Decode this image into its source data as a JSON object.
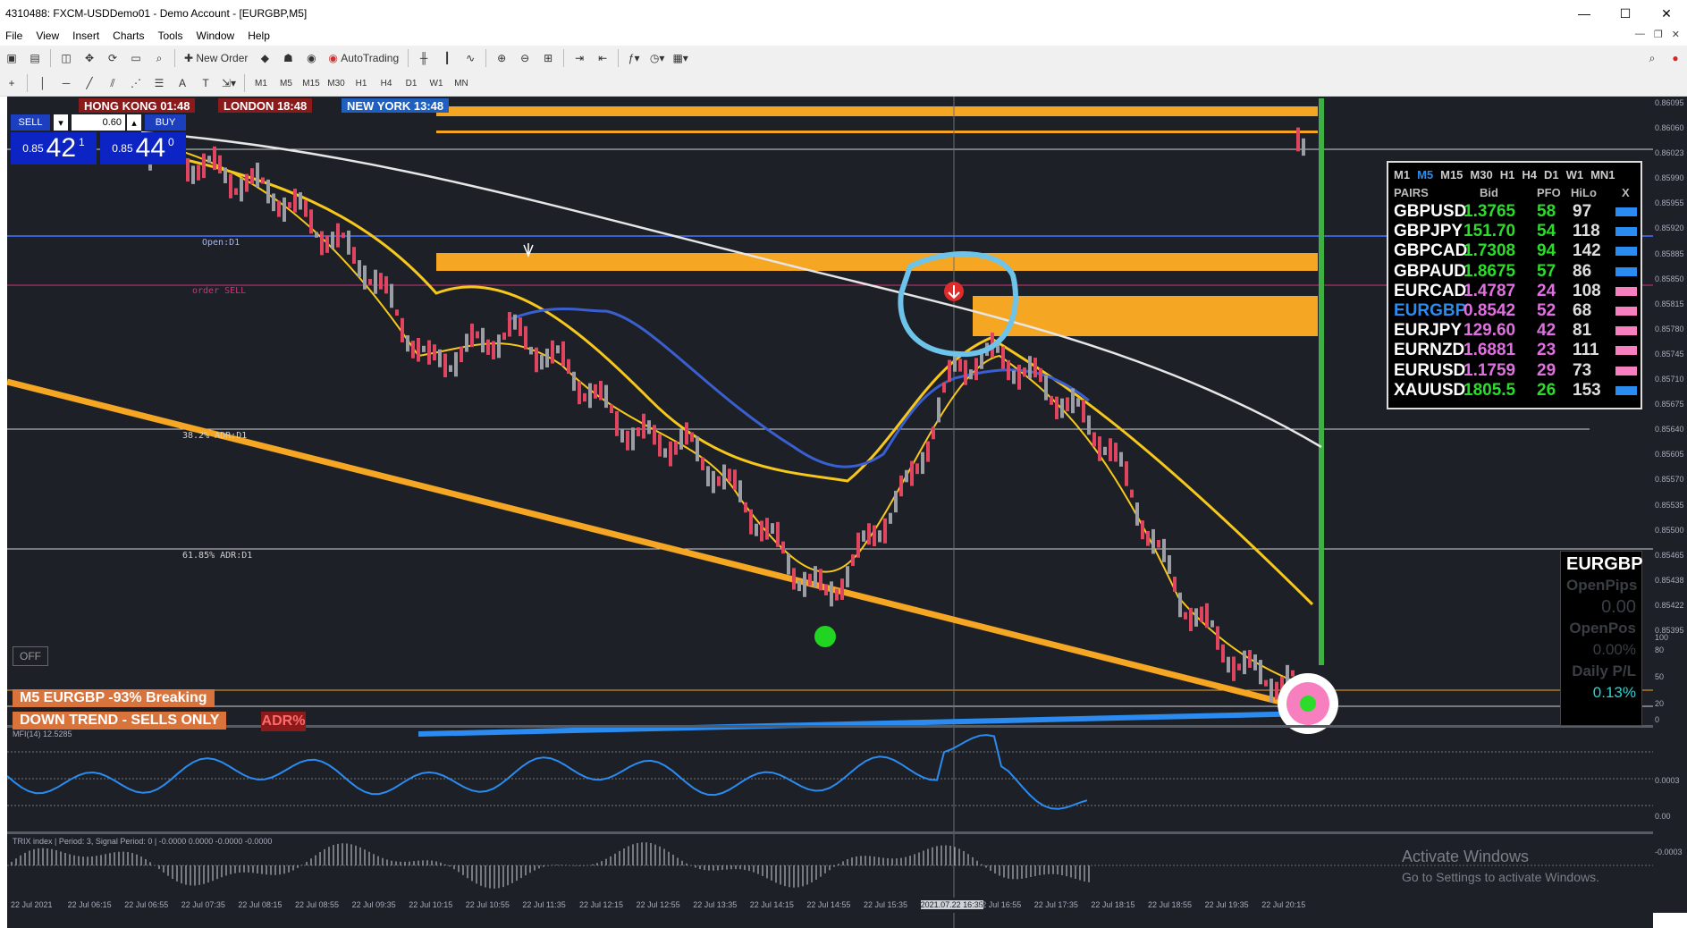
{
  "window": {
    "title": "4310488: FXCM-USDDemo01 - Demo Account - [EURGBP,M5]"
  },
  "menu": [
    "File",
    "View",
    "Insert",
    "Charts",
    "Tools",
    "Window",
    "Help"
  ],
  "toolbar": {
    "new_order": "New Order",
    "autotrading": "AutoTrading"
  },
  "timeframes": [
    "M1",
    "M5",
    "M15",
    "M30",
    "H1",
    "H4",
    "D1",
    "W1",
    "MN"
  ],
  "chart": {
    "symbol": "EURGBP,M5",
    "sessions": [
      {
        "label": "HONG KONG 01:48",
        "color": "#8b1a1a"
      },
      {
        "label": "LONDON  18:48",
        "color": "#8b1a1a"
      },
      {
        "label": "NEW YORK 13:48",
        "color": "#1f5fbf"
      }
    ],
    "trade": {
      "sell_label": "SELL",
      "buy_label": "BUY",
      "lot": "0.60",
      "sell_prefix": "0.85",
      "sell_big": "42",
      "sell_sup": "1",
      "buy_prefix": "0.85",
      "buy_big": "44",
      "buy_sup": "0"
    },
    "labels": {
      "open_d1": "Open:D1",
      "order_sell": "order SELL",
      "adr_382": "38.2% ADR:D1",
      "adr_618": "61.85% ADR:D1",
      "off": "OFF",
      "adr_badge": "ADR%"
    },
    "banners": {
      "breaking": "M5 EURGBP -93% Breaking",
      "trend": "DOWN TREND - SELLS ONLY"
    },
    "mfi_label": "MFI(14) 12.5285",
    "trix_label": "TRIX index | Period: 3, Signal Period: 0 | -0.0000 0.0000 -0.0000 -0.0000"
  },
  "price_scale": [
    "0.86095",
    "0.86060",
    "0.86023",
    "0.85990",
    "0.85955",
    "0.85920",
    "0.85885",
    "0.85850",
    "0.85815",
    "0.85780",
    "0.85745",
    "0.85710",
    "0.85675",
    "0.85640",
    "0.85605",
    "0.85570",
    "0.85535",
    "0.85500",
    "0.85465",
    "0.85438",
    "0.85422",
    "0.85395"
  ],
  "mfi_scale": [
    "100",
    "80",
    "50",
    "20",
    "0"
  ],
  "trix_scale": [
    "0.0003",
    "0.00",
    "-0.0003"
  ],
  "time_axis": [
    "22 Jul 2021",
    "22 Jul 06:15",
    "22 Jul 06:55",
    "22 Jul 07:35",
    "22 Jul 08:15",
    "22 Jul 08:55",
    "22 Jul 09:35",
    "22 Jul 10:15",
    "22 Jul 10:55",
    "22 Jul 11:35",
    "22 Jul 12:15",
    "22 Jul 12:55",
    "22 Jul 13:35",
    "22 Jul 14:15",
    "22 Jul 14:55",
    "22 Jul 15:35",
    "2021.07.22 16:35",
    "22 Jul 16:55",
    "22 Jul 17:35",
    "22 Jul 18:15",
    "22 Jul 18:55",
    "22 Jul 19:35",
    "22 Jul 20:15"
  ],
  "pairs_panel": {
    "timeframes": [
      "M1",
      "M5",
      "M15",
      "M30",
      "H1",
      "H4",
      "D1",
      "W1",
      "MN1"
    ],
    "active_tf": "M5",
    "headers": {
      "pairs": "PAIRS",
      "bid": "Bid",
      "pfo": "PFO",
      "hilo": "HiLo",
      "x": "X"
    },
    "rows": [
      {
        "pair": "GBPUSD",
        "bid": "1.3765",
        "pfo": "58",
        "hilo": "97",
        "bid_color": "#2bdc2b",
        "pfo_color": "#2bdc2b",
        "swatch": "#2a8cf0",
        "pair_color": "#ffffff"
      },
      {
        "pair": "GBPJPY",
        "bid": "151.70",
        "pfo": "54",
        "hilo": "118",
        "bid_color": "#2bdc2b",
        "pfo_color": "#2bdc2b",
        "swatch": "#2a8cf0",
        "pair_color": "#ffffff"
      },
      {
        "pair": "GBPCAD",
        "bid": "1.7308",
        "pfo": "94",
        "hilo": "142",
        "bid_color": "#2bdc2b",
        "pfo_color": "#2bdc2b",
        "swatch": "#2a8cf0",
        "pair_color": "#ffffff"
      },
      {
        "pair": "GBPAUD",
        "bid": "1.8675",
        "pfo": "57",
        "hilo": "86",
        "bid_color": "#2bdc2b",
        "pfo_color": "#2bdc2b",
        "swatch": "#2a8cf0",
        "pair_color": "#ffffff"
      },
      {
        "pair": "EURCAD",
        "bid": "1.4787",
        "pfo": "24",
        "hilo": "108",
        "bid_color": "#e070e0",
        "pfo_color": "#e070e0",
        "swatch": "#f77fbf",
        "pair_color": "#ffffff"
      },
      {
        "pair": "EURGBP",
        "bid": "0.8542",
        "pfo": "52",
        "hilo": "68",
        "bid_color": "#e070e0",
        "pfo_color": "#e070e0",
        "swatch": "#f77fbf",
        "pair_color": "#2a8cf0"
      },
      {
        "pair": "EURJPY",
        "bid": "129.60",
        "pfo": "42",
        "hilo": "81",
        "bid_color": "#e070e0",
        "pfo_color": "#e070e0",
        "swatch": "#f77fbf",
        "pair_color": "#ffffff"
      },
      {
        "pair": "EURNZD",
        "bid": "1.6881",
        "pfo": "23",
        "hilo": "111",
        "bid_color": "#e070e0",
        "pfo_color": "#e070e0",
        "swatch": "#f77fbf",
        "pair_color": "#ffffff"
      },
      {
        "pair": "EURUSD",
        "bid": "1.1759",
        "pfo": "29",
        "hilo": "73",
        "bid_color": "#e070e0",
        "pfo_color": "#e070e0",
        "swatch": "#f77fbf",
        "pair_color": "#ffffff"
      },
      {
        "pair": "XAUUSD",
        "bid": "1805.5",
        "pfo": "26",
        "hilo": "153",
        "bid_color": "#2bdc2b",
        "pfo_color": "#2bdc2b",
        "swatch": "#2a8cf0",
        "pair_color": "#ffffff"
      }
    ]
  },
  "eur_panel": {
    "symbol": "EURGBP",
    "open_pips_label": "OpenPips",
    "open_pips": "0.00",
    "open_pos_label": "OpenPos",
    "open_pos": "0.00%",
    "daily_pl_label": "Daily P/L",
    "daily_pl": "0.13%"
  },
  "os_watermark": {
    "line1": "Activate Windows",
    "line2": "Go to Settings to activate Windows."
  }
}
